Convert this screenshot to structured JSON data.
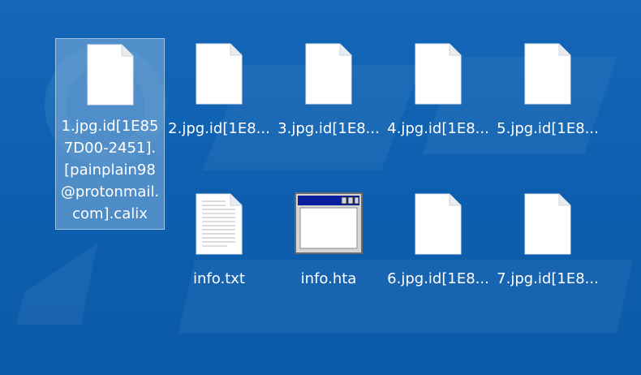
{
  "desktop": {
    "files": [
      {
        "label": "1.jpg.id[1E857D00-2451].[painplain98@protonmail.com].calix",
        "icon": "blank-document-icon",
        "selected": true
      },
      {
        "label": "2.jpg.id[1E8...",
        "icon": "blank-document-icon",
        "selected": false
      },
      {
        "label": "3.jpg.id[1E8...",
        "icon": "blank-document-icon",
        "selected": false
      },
      {
        "label": "4.jpg.id[1E8...",
        "icon": "blank-document-icon",
        "selected": false
      },
      {
        "label": "5.jpg.id[1E8...",
        "icon": "blank-document-icon",
        "selected": false
      },
      {
        "label": "info.txt",
        "icon": "text-document-icon",
        "selected": false
      },
      {
        "label": "info.hta",
        "icon": "application-window-icon",
        "selected": false
      },
      {
        "label": "6.jpg.id[1E8...",
        "icon": "blank-document-icon",
        "selected": false
      },
      {
        "label": "7.jpg.id[1E8...",
        "icon": "blank-document-icon",
        "selected": false
      }
    ],
    "colors": {
      "background": "#0f61b3",
      "selection": "#78aad7",
      "label": "#ffffff"
    }
  }
}
